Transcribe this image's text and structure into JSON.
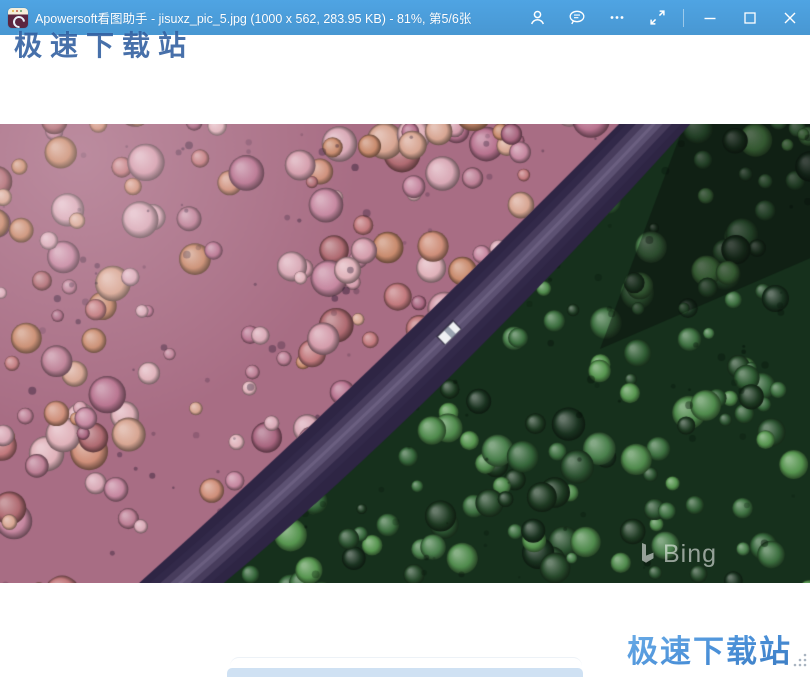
{
  "window": {
    "title": "Apowersoft看图助手 - jisuxz_pic_5.jpg (1000 x 562, 283.95 KB) - 81%, 第5/6张"
  },
  "titlebar": {
    "icons": [
      "user",
      "feedback",
      "more",
      "fullscreen",
      "minimize",
      "maximize",
      "close"
    ]
  },
  "watermarks": {
    "site_top": "极速下载站",
    "site_bottom": "极速下载站",
    "photo_brand": "Bing"
  },
  "photo": {
    "description": "aerial drone view of forest, pink autumn trees upper-left, green trees lower-right, diagonal road with white car",
    "zoom_percent": "81%",
    "position_in_set": "第5/6张"
  },
  "colors": {
    "titlebar_blue": "#4B9EDC",
    "watermark_top_blue": "#2D5C9E",
    "watermark_bottom_blue": "#4A90D8",
    "bottom_bar_blue": "#CFE1F3"
  }
}
